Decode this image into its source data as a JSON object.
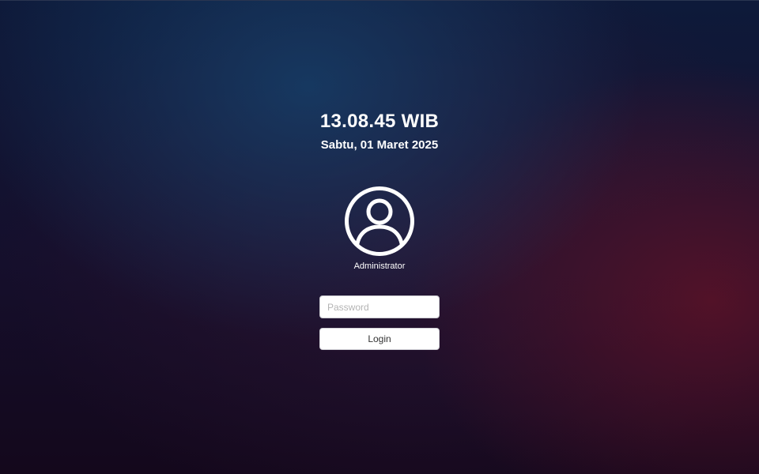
{
  "lock_screen": {
    "time": "13.08.45 WIB",
    "date": "Sabtu, 01 Maret 2025",
    "avatar_icon": "user-circle-icon",
    "username": "Administrator",
    "password": {
      "value": "",
      "placeholder": "Password"
    },
    "login_label": "Login"
  },
  "colors": {
    "text": "#ffffff",
    "background_top": "#0e1a3a",
    "background_glow_blue": "#163e68",
    "background_glow_red": "#5c1228"
  }
}
